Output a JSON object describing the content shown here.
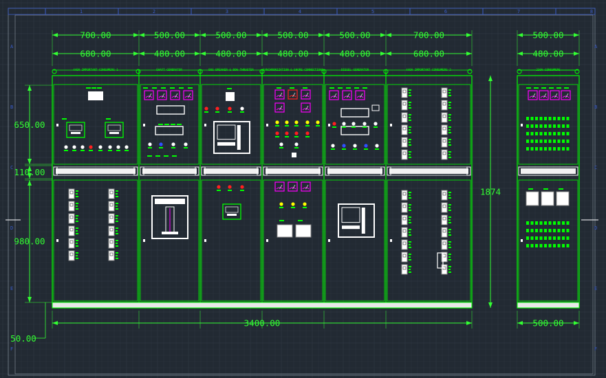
{
  "drawing": {
    "colors": {
      "background": "#222a33",
      "grid_minor": "#2b333d",
      "grid_major": "#323b46",
      "frame": "#ffffff",
      "dimension": "#33ff33",
      "panel_outline": "#00ff00",
      "meter_magenta": "#ff00ff",
      "lamp_red": "#ff2020",
      "lamp_yellow": "#ffff00",
      "lamp_blue": "#3050ff",
      "device_white": "#ffffff",
      "ruler_blue": "#3a5cc8"
    },
    "top_dimensions_outer": [
      "700.00",
      "500.00",
      "500.00",
      "500.00",
      "500.00",
      "700.00"
    ],
    "top_dimensions_inner": [
      "680.00",
      "480.00",
      "480.00",
      "480.00",
      "480.00",
      "680.00"
    ],
    "right_dimension_outer": "500.00",
    "right_dimension_inner": "480.00",
    "left_dimensions": [
      "650.00",
      "110.00",
      "980.00"
    ],
    "left_bottom_dimension": "50.00",
    "bottom_dimension": "3400.00",
    "bottom_right_dimension": "500.00",
    "height_dimension": "1874",
    "section_titles": [
      "440V IMPORTANT CONSUMERS 1",
      "SHAFT GENERATOR",
      "BUS BREAKER & BOW THRUSTER",
      "SYNCHRONIZATION & SHORE CONNECTIONS",
      "DIESEL GENERATOR",
      "440V IMPORTANT CONSUMERS 2",
      "230V CONSUMERS"
    ],
    "ruler_numbers": [
      "1",
      "2",
      "3",
      "4",
      "5",
      "6",
      "7",
      "8"
    ],
    "ruler_letters": [
      "A",
      "B",
      "C",
      "D",
      "E",
      "F"
    ]
  }
}
